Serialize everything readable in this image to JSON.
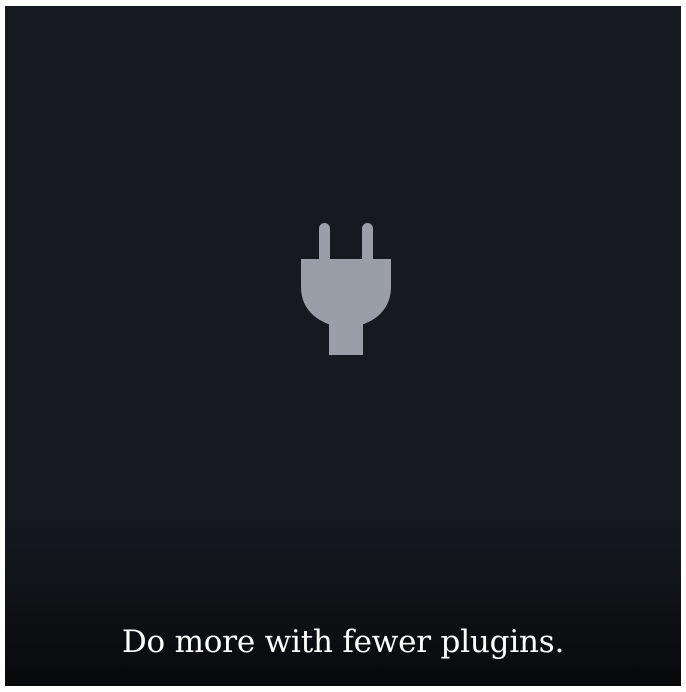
{
  "card": {
    "icon": "plug-icon",
    "background_color": "#161a20",
    "icon_color": "#9a9ea8",
    "caption": "Do more with fewer plugins."
  }
}
